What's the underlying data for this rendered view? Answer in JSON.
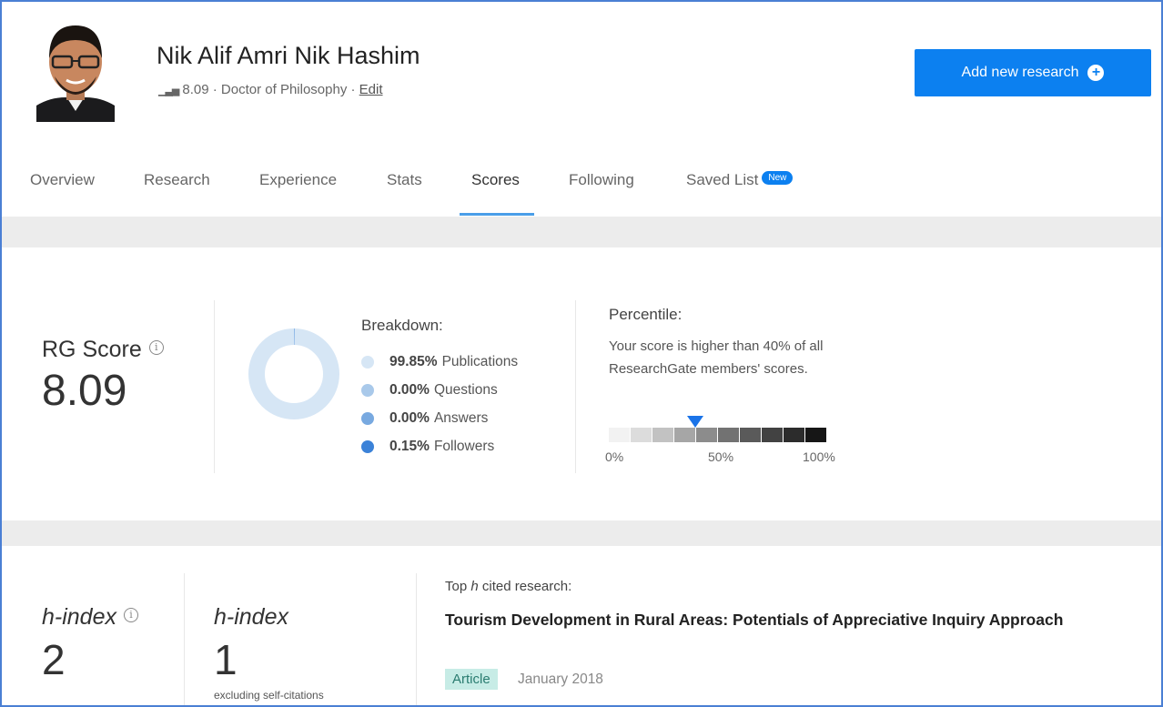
{
  "profile": {
    "name": "Nik Alif Amri Nik Hashim",
    "score": "8.09",
    "degree": "· Doctor of Philosophy ·",
    "edit_label": "Edit",
    "add_button_label": "Add new research"
  },
  "tabs": [
    {
      "label": "Overview",
      "active": false
    },
    {
      "label": "Research",
      "active": false
    },
    {
      "label": "Experience",
      "active": false
    },
    {
      "label": "Stats",
      "active": false
    },
    {
      "label": "Scores",
      "active": true
    },
    {
      "label": "Following",
      "active": false
    },
    {
      "label": "Saved List",
      "active": false,
      "badge": "New"
    }
  ],
  "rg_score": {
    "label": "RG Score",
    "value": "8.09",
    "breakdown_title": "Breakdown:",
    "breakdown": [
      {
        "pct": "99.85%",
        "label": "Publications",
        "color": "#d6e6f5"
      },
      {
        "pct": "0.00%",
        "label": "Questions",
        "color": "#a9c9ea"
      },
      {
        "pct": "0.00%",
        "label": "Answers",
        "color": "#78a9e0"
      },
      {
        "pct": "0.15%",
        "label": "Followers",
        "color": "#3b82d8"
      }
    ],
    "percentile_title": "Percentile:",
    "percentile_text": "Your score is higher than 40% of all ResearchGate members' scores.",
    "percentile_value": 40,
    "percentile_labels": [
      "0%",
      "50%",
      "100%"
    ]
  },
  "h_index": {
    "label": "h-index",
    "value": "2",
    "excl_value": "1",
    "excl_note": "excluding self-citations",
    "top_label_prefix": "Top",
    "top_label_suffix": "cited research:",
    "top_paper_title": "Tourism Development in Rural Areas: Potentials of Appreciative Inquiry Approach",
    "top_paper_type": "Article",
    "top_paper_date": "January 2018"
  }
}
